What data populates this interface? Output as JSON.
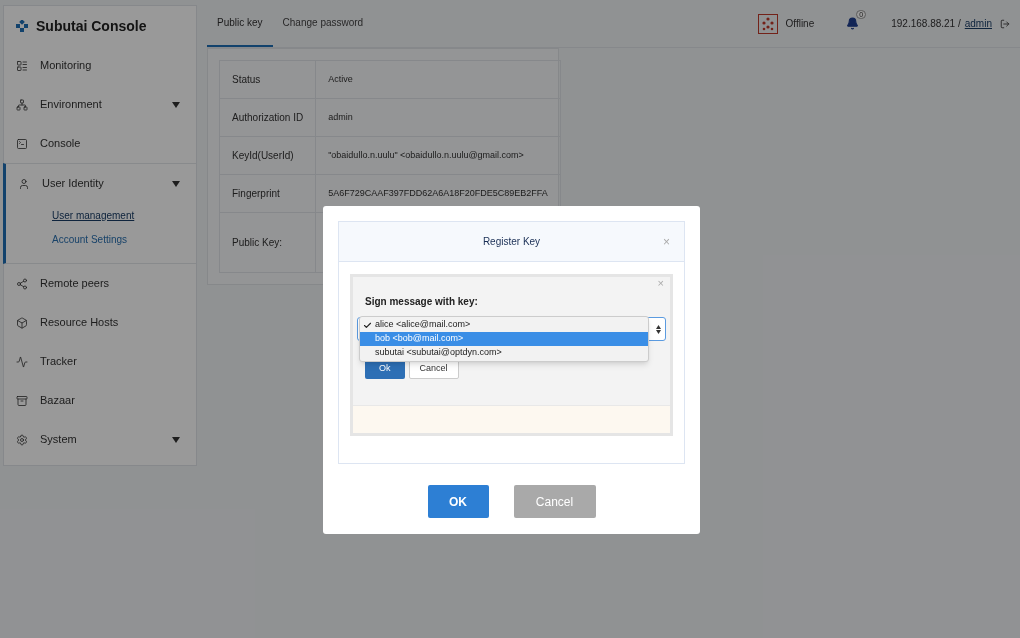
{
  "brand": {
    "title": "Subutai Console"
  },
  "sidebar": {
    "items": [
      {
        "label": "Monitoring",
        "kind": "link"
      },
      {
        "label": "Environment",
        "kind": "group",
        "expanded": false
      },
      {
        "label": "Console",
        "kind": "link"
      },
      {
        "label": "User Identity",
        "kind": "group",
        "expanded": true,
        "children": [
          {
            "label": "User management",
            "selected": true
          },
          {
            "label": "Account Settings",
            "selected": false
          }
        ]
      },
      {
        "label": "Remote peers",
        "kind": "link"
      },
      {
        "label": "Resource Hosts",
        "kind": "link"
      },
      {
        "label": "Tracker",
        "kind": "link"
      },
      {
        "label": "Bazaar",
        "kind": "link"
      },
      {
        "label": "System",
        "kind": "group",
        "expanded": false
      }
    ]
  },
  "tabs": [
    {
      "label": "Public key",
      "selected": true
    },
    {
      "label": "Change password",
      "selected": false
    }
  ],
  "header": {
    "status": "Offline",
    "notifications": "0",
    "host": "192.168.88.21 /",
    "user": "admin"
  },
  "table": {
    "rows": [
      {
        "label": "Status",
        "value": "Active"
      },
      {
        "label": "Authorization ID",
        "value": "admin"
      },
      {
        "label": "KeyId(UserId)",
        "value": "\"obaidullo.n.uulu\" <obaidullo.n.uulu@gmail.com>"
      },
      {
        "label": "Fingerprint",
        "value": "5A6F729CAAF397FDD62A6A18F20FDE5C89EB2FFA"
      },
      {
        "label": "Public Key:",
        "value": ""
      }
    ]
  },
  "modal": {
    "title": "Register Key",
    "close": "×",
    "inner": {
      "close": "×",
      "label": "Sign message with key:",
      "options": [
        {
          "label": "alice <alice@mail.com>",
          "selected": true,
          "highlighted": false
        },
        {
          "label": "bob <bob@mail.com>",
          "selected": false,
          "highlighted": true
        },
        {
          "label": "subutai <subutai@optdyn.com>",
          "selected": false,
          "highlighted": false
        }
      ],
      "buttons": [
        "Ok",
        "Cancel"
      ]
    },
    "buttons": [
      "OK",
      "Cancel"
    ]
  }
}
